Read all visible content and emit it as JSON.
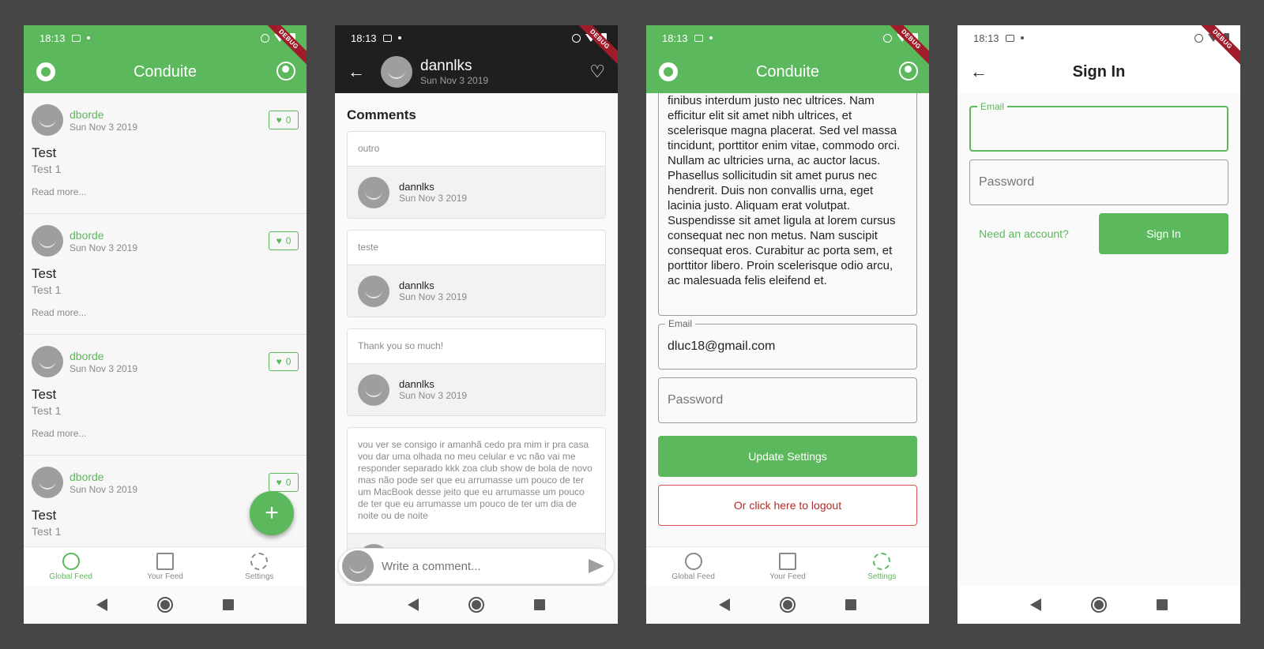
{
  "status": {
    "time": "18:13"
  },
  "debug_banner": "DEBUG",
  "colors": {
    "accent": "#5cb85c",
    "danger": "#d9534f",
    "dark_bar": "#1f1f1f",
    "background": "#464646"
  },
  "feed": {
    "app_title": "Conduite",
    "articles": [
      {
        "author": "dborde",
        "date": "Sun Nov 3 2019",
        "likes": "0",
        "title": "Test",
        "description": "Test 1",
        "read_more": "Read more..."
      },
      {
        "author": "dborde",
        "date": "Sun Nov 3 2019",
        "likes": "0",
        "title": "Test",
        "description": "Test 1",
        "read_more": "Read more..."
      },
      {
        "author": "dborde",
        "date": "Sun Nov 3 2019",
        "likes": "0",
        "title": "Test",
        "description": "Test 1",
        "read_more": "Read more..."
      },
      {
        "author": "dborde",
        "date": "Sun Nov 3 2019",
        "likes": "0",
        "title": "Test",
        "description": "Test 1",
        "read_more": ""
      }
    ],
    "fab_label": "+",
    "nav": [
      "Global Feed",
      "Your Feed",
      "Settings"
    ]
  },
  "article_detail": {
    "author": "dannlks",
    "date": "Sun Nov 3 2019",
    "comments_title": "Comments",
    "comments": [
      {
        "body": "outro",
        "author": "dannlks",
        "date": "Sun Nov 3 2019"
      },
      {
        "body": "teste",
        "author": "dannlks",
        "date": "Sun Nov 3 2019"
      },
      {
        "body": "Thank you so much!",
        "author": "dannlks",
        "date": "Sun Nov 3 2019"
      },
      {
        "body": "vou ver se consigo ir amanhã cedo pra mim ir pra casa vou dar uma olhada no meu celular e vc não vai me responder separado kkk zoa club show de bola de novo mas não pode ser que eu arrumasse um pouco de ter um MacBook desse jeito que eu arrumasse um pouco de ter que eu arrumasse um pouco de ter um dia de noite ou de noite",
        "author": "",
        "date": ""
      }
    ],
    "comment_placeholder": "Write a comment..."
  },
  "settings": {
    "app_title": "Conduite",
    "bio_text": "finibus interdum justo nec ultrices. Nam efficitur elit sit amet nibh ultrices, et scelerisque magna placerat. Sed vel massa tincidunt, porttitor enim vitae, commodo orci. Nullam ac ultricies urna, ac auctor lacus. Phasellus sollicitudin sit amet purus nec hendrerit. Duis non convallis urna, eget lacinia justo. Aliquam erat volutpat. Suspendisse sit amet ligula at lorem cursus consequat nec non metus. Nam suscipit consequat eros. Curabitur ac porta sem, et porttitor libero. Proin scelerisque odio arcu, ac malesuada felis eleifend et.",
    "email_label": "Email",
    "email_value": "dluc18@gmail.com",
    "password_placeholder": "Password",
    "update_button": "Update Settings",
    "logout_button": "Or click here to logout",
    "nav": [
      "Global Feed",
      "Your Feed",
      "Settings"
    ]
  },
  "signin": {
    "title": "Sign In",
    "email_label": "Email",
    "password_placeholder": "Password",
    "need_account": "Need an account?",
    "signin_button": "Sign In"
  }
}
